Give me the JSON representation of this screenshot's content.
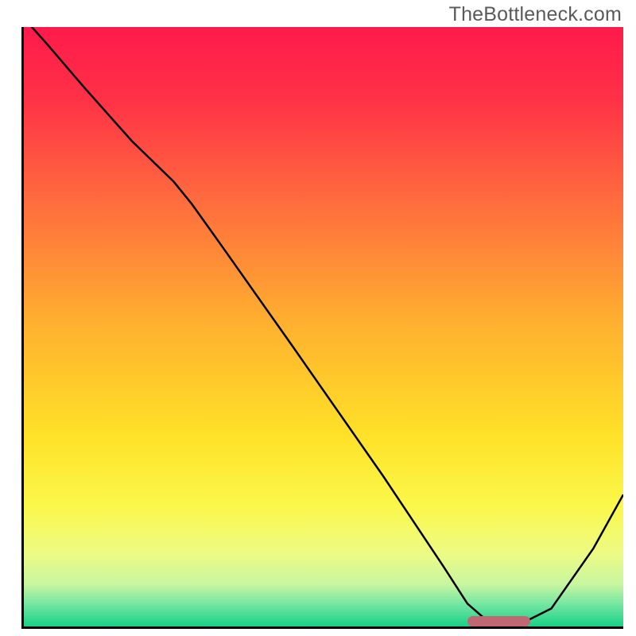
{
  "watermark": "TheBottleneck.com",
  "chart_data": {
    "type": "line",
    "title": "",
    "xlabel": "",
    "ylabel": "",
    "xlim": [
      0,
      100
    ],
    "ylim": [
      0,
      100
    ],
    "background_gradient": {
      "stops": [
        {
          "offset": 0.0,
          "color": "#ff1a4b"
        },
        {
          "offset": 0.12,
          "color": "#ff3147"
        },
        {
          "offset": 0.3,
          "color": "#ff6f3d"
        },
        {
          "offset": 0.5,
          "color": "#ffb22f"
        },
        {
          "offset": 0.68,
          "color": "#ffe128"
        },
        {
          "offset": 0.8,
          "color": "#fbf84b"
        },
        {
          "offset": 0.88,
          "color": "#ecfb85"
        },
        {
          "offset": 0.93,
          "color": "#c7f6a0"
        },
        {
          "offset": 0.965,
          "color": "#6fe5a2"
        },
        {
          "offset": 1.0,
          "color": "#18d184"
        }
      ]
    },
    "series": [
      {
        "name": "bottleneck-curve",
        "color": "#000000",
        "x": [
          0.0,
          4.0,
          10.0,
          18.0,
          25.0,
          28.0,
          33.0,
          45.0,
          60.0,
          70.0,
          74.0,
          77.0,
          80.0,
          84.0,
          88.0,
          95.0,
          100.0
        ],
        "y": [
          101.5,
          97.0,
          90.0,
          81.0,
          74.2,
          70.5,
          63.5,
          46.5,
          25.0,
          10.0,
          3.8,
          1.2,
          0.8,
          1.0,
          3.0,
          13.0,
          22.0
        ]
      }
    ],
    "marker": {
      "name": "optimal-range",
      "color": "#c06774",
      "x_start": 74.0,
      "x_end": 84.5,
      "y": 0.0
    }
  }
}
